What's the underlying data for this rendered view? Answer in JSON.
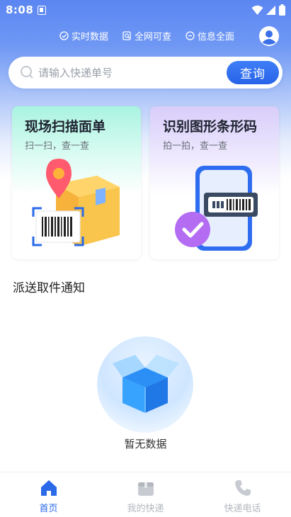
{
  "status_bar": {
    "time": "8:08"
  },
  "features": [
    {
      "icon": "clock-icon",
      "label": "实时数据"
    },
    {
      "icon": "search-doc-icon",
      "label": "全网可查"
    },
    {
      "icon": "info-circle-icon",
      "label": "信息全面"
    }
  ],
  "search": {
    "placeholder": "请输入快递单号",
    "button_label": "查询"
  },
  "cards": [
    {
      "title": "现场扫描面单",
      "subtitle": "扫一扫，查一查"
    },
    {
      "title": "识别图形条形码",
      "subtitle": "拍一拍，查一查"
    }
  ],
  "notice_section": {
    "title": "派送取件通知",
    "empty_text": "暂无数据"
  },
  "tabs": [
    {
      "label": "首页",
      "icon": "home-icon",
      "active": true
    },
    {
      "label": "我的快递",
      "icon": "package-icon",
      "active": false
    },
    {
      "label": "快递电话",
      "icon": "phone-icon",
      "active": false
    }
  ],
  "colors": {
    "primary": "#2a6ae9",
    "header_blue": "#5b86f2",
    "inactive": "#b3b7bd"
  }
}
